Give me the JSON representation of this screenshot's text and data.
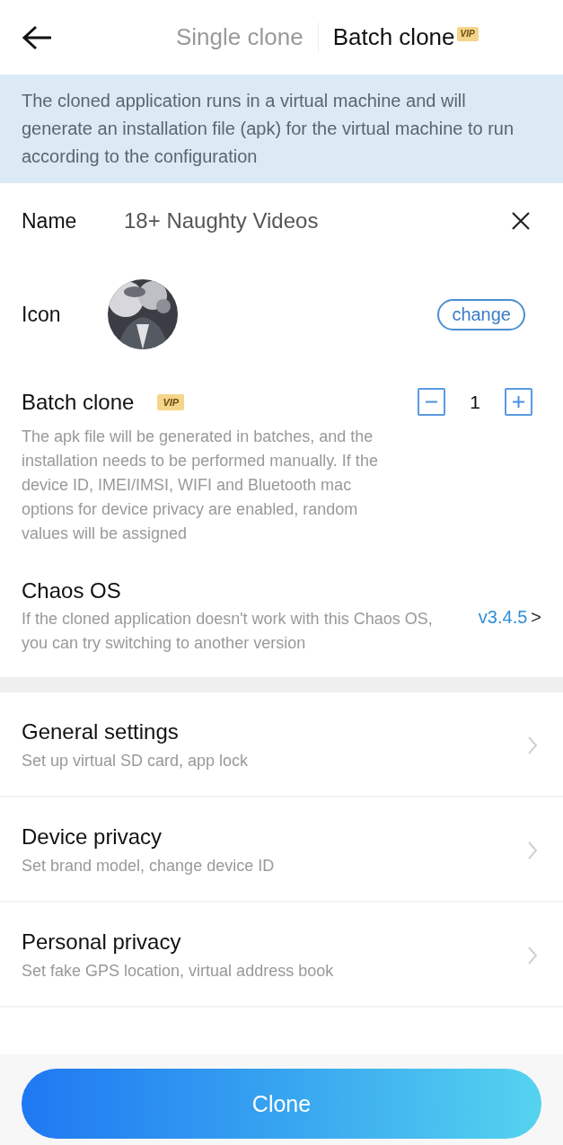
{
  "tabs": [
    {
      "label": "Single clone",
      "selected": false
    },
    {
      "label": "Batch clone",
      "selected": true,
      "badge": "VIP"
    }
  ],
  "notice": "The cloned application runs in a virtual machine and will generate an installation file (apk) for the virtual machine to run according to the configuration",
  "name": {
    "label": "Name",
    "value": "18+ Naughty Videos"
  },
  "icon": {
    "label": "Icon",
    "button": "change"
  },
  "batch_clone": {
    "title": "Batch clone",
    "badge": "VIP",
    "count": "1",
    "description": "The apk file will be generated in batches, and the installation needs to be performed manually. If the device ID, IMEI/IMSI, WIFI and Bluetooth mac options for device privacy are enabled, random values will be assigned"
  },
  "chaos_os": {
    "title": "Chaos OS",
    "description": "If the cloned application doesn't work with this Chaos OS, you can try switching to another version",
    "version": "v3.4.5",
    "chevron": ">"
  },
  "settings": [
    {
      "title": "General settings",
      "subtitle": "Set up virtual SD card, app lock"
    },
    {
      "title": "Device privacy",
      "subtitle": "Set brand model, change device ID"
    },
    {
      "title": "Personal privacy",
      "subtitle": "Set fake GPS location, virtual address book"
    }
  ],
  "clone_button": "Clone"
}
